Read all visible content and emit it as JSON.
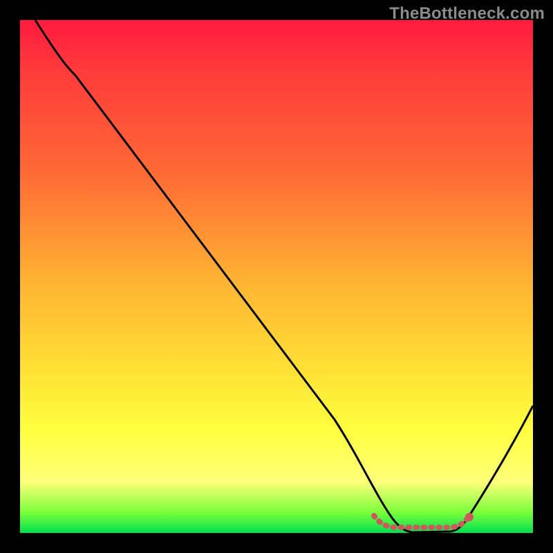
{
  "watermark": "TheBottleneck.com",
  "chart_data": {
    "type": "line",
    "title": "",
    "xlabel": "",
    "ylabel": "",
    "xlim": [
      0,
      100
    ],
    "ylim": [
      0,
      100
    ],
    "grid": false,
    "legend": false,
    "series": [
      {
        "name": "bottleneck-curve",
        "x": [
          3,
          10,
          20,
          30,
          40,
          50,
          62,
          70,
          74,
          78,
          82,
          86,
          100
        ],
        "y": [
          100,
          91,
          78,
          65,
          52,
          39,
          22,
          8,
          2,
          0,
          0,
          2,
          25
        ],
        "color": "#000000"
      }
    ],
    "flat_zone": {
      "name": "optimal-range",
      "x_start": 70,
      "x_end": 86,
      "y": 1.5,
      "color": "#cc5a5a"
    },
    "end_marker": {
      "x": 86,
      "y": 2.2,
      "color": "#cc5a5a",
      "r": 5
    },
    "background_gradient": [
      "#ff1a40",
      "#ff6a35",
      "#ffe035",
      "#ffff7a",
      "#00e050"
    ]
  }
}
